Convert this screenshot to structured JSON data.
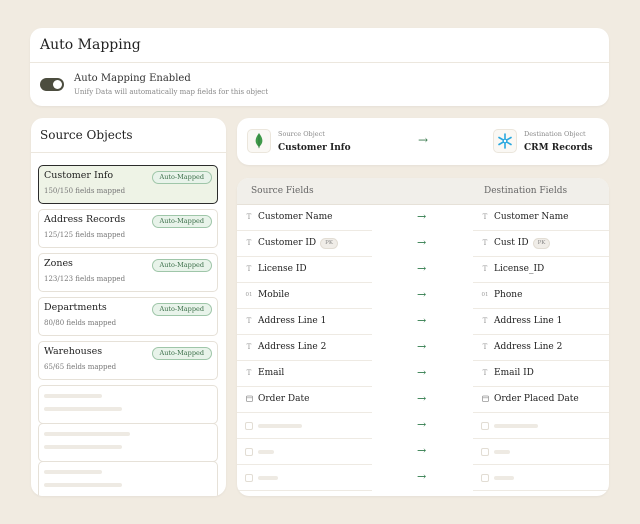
{
  "auto_mapping": {
    "title": "Auto Mapping",
    "toggle_label": "Auto Mapping Enabled",
    "toggle_description": "Unify Data will automatically map fields for this object",
    "enabled": true
  },
  "source_objects": {
    "title": "Source Objects",
    "items": [
      {
        "name": "Customer Info",
        "count": "150/150 fields mapped",
        "badge": "Auto-Mapped",
        "selected": true
      },
      {
        "name": "Address Records",
        "count": "125/125 fields mapped",
        "badge": "Auto-Mapped"
      },
      {
        "name": "Zones",
        "count": "123/123 fields mapped",
        "badge": "Auto-Mapped"
      },
      {
        "name": "Departments",
        "count": "80/80 fields mapped",
        "badge": "Auto-Mapped"
      },
      {
        "name": "Warehouses",
        "count": "65/65 fields mapped",
        "badge": "Auto-Mapped"
      }
    ]
  },
  "object_header": {
    "source_label": "Source Object",
    "source_value": "Customer Info",
    "source_icon": "mongodb-leaf-icon",
    "arrow": "→",
    "destination_label": "Destination Object",
    "destination_value": "CRM Records",
    "destination_icon": "snowflake-icon"
  },
  "field_map": {
    "source_header": "Source Fields",
    "destination_header": "Destination Fields",
    "arrow": "→",
    "rows": [
      {
        "src_type": "T",
        "src": "Customer Name",
        "dst_type": "T",
        "dst": "Customer Name"
      },
      {
        "src_type": "T",
        "src": "Customer ID",
        "src_pk": "PK",
        "dst_type": "T",
        "dst": "Cust ID",
        "dst_pk": "PK"
      },
      {
        "src_type": "T",
        "src": "License ID",
        "dst_type": "T",
        "dst": "License_ID"
      },
      {
        "src_type": "01",
        "src": "Mobile",
        "dst_type": "01",
        "dst": "Phone"
      },
      {
        "src_type": "T",
        "src": "Address Line 1",
        "dst_type": "T",
        "dst": "Address Line 1"
      },
      {
        "src_type": "T",
        "src": "Address Line 2",
        "dst_type": "T",
        "dst": "Address Line 2"
      },
      {
        "src_type": "T",
        "src": "Email",
        "dst_type": "T",
        "dst": "Email ID"
      },
      {
        "src_type": "date",
        "src": "Order Date",
        "dst_type": "date",
        "dst": "Order Placed Date"
      }
    ]
  },
  "colors": {
    "background": "#f1ebe1",
    "accent_green": "#2f7a4a",
    "badge_bg": "#e8f3ea",
    "selected_bg": "#eef3e6"
  }
}
